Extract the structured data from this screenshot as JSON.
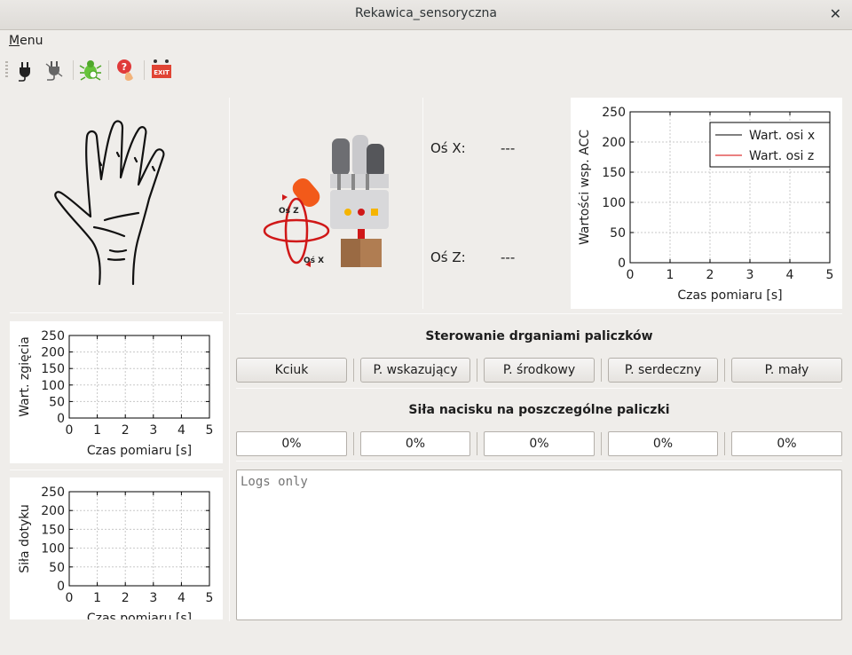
{
  "window": {
    "title": "Rekawica_sensoryczna",
    "close_glyph": "✕"
  },
  "menu": {
    "label_accel": "M",
    "label_rest": "enu"
  },
  "toolbar": {
    "icons": [
      "plug-connect-icon",
      "plug-disconnect-icon",
      "bug-icon",
      "help-icon",
      "exit-icon"
    ],
    "exit_text": "EXIT"
  },
  "orientation": {
    "axis_x_label": "Oś X:",
    "axis_x_value": "---",
    "axis_z_label": "Oś Z:",
    "axis_z_value": "---",
    "diagram_label_z": "Oś Z",
    "diagram_label_x": "Oś X"
  },
  "vibration": {
    "title": "Sterowanie drganiami paliczków",
    "buttons": [
      "Kciuk",
      "P. wskazujący",
      "P. środkowy",
      "P. serdeczny",
      "P. mały"
    ]
  },
  "pressure": {
    "title": "Siła nacisku na poszczególne paliczki",
    "values": [
      "0%",
      "0%",
      "0%",
      "0%",
      "0%"
    ]
  },
  "logs": {
    "placeholder": "Logs only"
  },
  "chart_data": [
    {
      "type": "line",
      "xlabel": "Czas pomiaru [s]",
      "ylabel": "Wartości wsp. ACC",
      "xlim": [
        0,
        5
      ],
      "ylim": [
        0,
        250
      ],
      "xticks": [
        "0",
        "1",
        "2",
        "3",
        "4",
        "5"
      ],
      "yticks": [
        "0",
        "50",
        "100",
        "150",
        "200",
        "250"
      ],
      "grid": true,
      "legend": "top-right",
      "series": [
        {
          "name": "Wart. osi x",
          "color": "#000000",
          "x": [],
          "y": []
        },
        {
          "name": "Wart. osi z",
          "color": "#d40000",
          "x": [],
          "y": []
        }
      ]
    },
    {
      "type": "line",
      "xlabel": "Czas pomiaru [s]",
      "ylabel": "Wart. zgięcia",
      "xlim": [
        0,
        5
      ],
      "ylim": [
        0,
        250
      ],
      "xticks": [
        "0",
        "1",
        "2",
        "3",
        "4",
        "5"
      ],
      "yticks": [
        "0",
        "50",
        "100",
        "150",
        "200",
        "250"
      ],
      "grid": true,
      "series": []
    },
    {
      "type": "line",
      "xlabel": "Czas pomiaru [s]",
      "ylabel": "Siła dotyku",
      "xlim": [
        0,
        5
      ],
      "ylim": [
        0,
        250
      ],
      "xticks": [
        "0",
        "1",
        "2",
        "3",
        "4",
        "5"
      ],
      "yticks": [
        "0",
        "50",
        "100",
        "150",
        "200",
        "250"
      ],
      "grid": true,
      "series": []
    }
  ]
}
